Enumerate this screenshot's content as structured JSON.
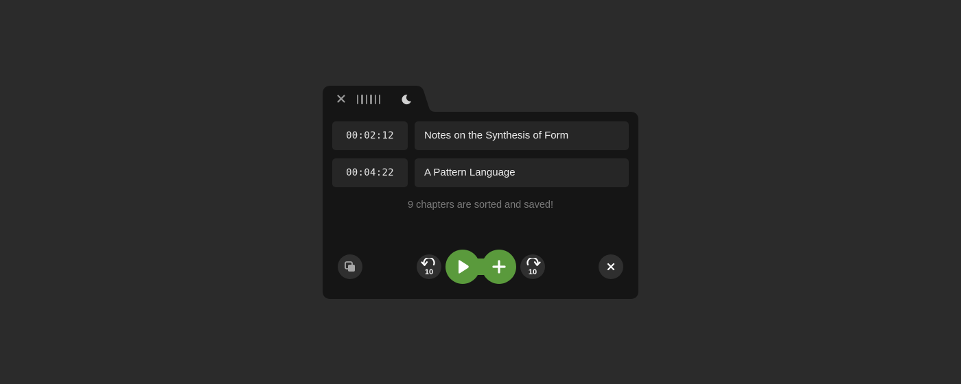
{
  "window": {
    "tab_icons": [
      "close-icon",
      "drag-handle-icon",
      "moon-icon"
    ]
  },
  "tracks": [
    {
      "time": "00:02:12",
      "title": "Notes on the Synthesis of Form"
    },
    {
      "time": "00:04:22",
      "title": "A Pattern Language"
    }
  ],
  "status": "9 chapters are sorted and saved!",
  "controls": {
    "rewind_seconds": "10",
    "forward_seconds": "10",
    "icons": [
      "copy-icon",
      "rewind-10-icon",
      "play-icon",
      "plus-icon",
      "forward-10-icon",
      "close-icon"
    ]
  },
  "colors": {
    "background": "#2b2b2b",
    "window": "#151515",
    "field": "#262626",
    "accent": "#5a9a3c",
    "status_text": "#7a7a7a"
  }
}
